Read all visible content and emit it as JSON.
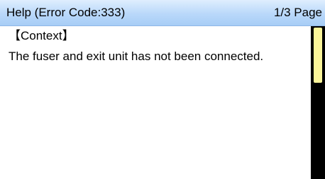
{
  "header": {
    "title": "Help (Error Code:333)",
    "page_indicator": "1/3 Page"
  },
  "content": {
    "section_heading": "【Context】",
    "message": "The fuser and exit unit has not been connected."
  },
  "scrollbar": {
    "position_fraction": 0.0,
    "visible_fraction": 0.36
  },
  "colors": {
    "header_background": "#b9d8fa",
    "scrollbar_track": "#000000",
    "scrollbar_thumb": "#fbf59a"
  }
}
